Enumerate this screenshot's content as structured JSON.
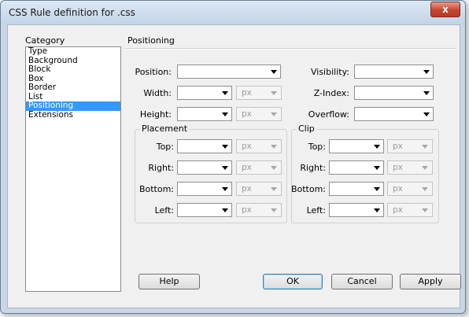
{
  "window": {
    "title": "CSS Rule definition for .css",
    "close_symbol": "x"
  },
  "category": {
    "label": "Category",
    "items": [
      "Type",
      "Background",
      "Block",
      "Box",
      "Border",
      "List",
      "Positioning",
      "Extensions"
    ],
    "selected": "Positioning"
  },
  "section": {
    "title": "Positioning"
  },
  "fields": {
    "position": {
      "label": "Position:",
      "value": ""
    },
    "width": {
      "label": "Width:",
      "value": "",
      "unit": "px"
    },
    "height": {
      "label": "Height:",
      "value": "",
      "unit": "px"
    },
    "visibility": {
      "label": "Visibility:",
      "value": ""
    },
    "zindex": {
      "label": "Z-Index:",
      "value": ""
    },
    "overflow": {
      "label": "Overflow:",
      "value": ""
    }
  },
  "placement": {
    "title": "Placement",
    "rows": [
      {
        "label": "Top:",
        "value": "",
        "unit": "px"
      },
      {
        "label": "Right:",
        "value": "",
        "unit": "px"
      },
      {
        "label": "Bottom:",
        "value": "",
        "unit": "px"
      },
      {
        "label": "Left:",
        "value": "",
        "unit": "px"
      }
    ]
  },
  "clip": {
    "title": "Clip",
    "rows": [
      {
        "label": "Top:",
        "value": "",
        "unit": "px"
      },
      {
        "label": "Right:",
        "value": "",
        "unit": "px"
      },
      {
        "label": "Bottom:",
        "value": "",
        "unit": "px"
      },
      {
        "label": "Left:",
        "value": "",
        "unit": "px"
      }
    ]
  },
  "buttons": {
    "help": "Help",
    "ok": "OK",
    "cancel": "Cancel",
    "apply": "Apply"
  },
  "colors": {
    "selection": "#3399ff",
    "close": "#c8462f"
  }
}
